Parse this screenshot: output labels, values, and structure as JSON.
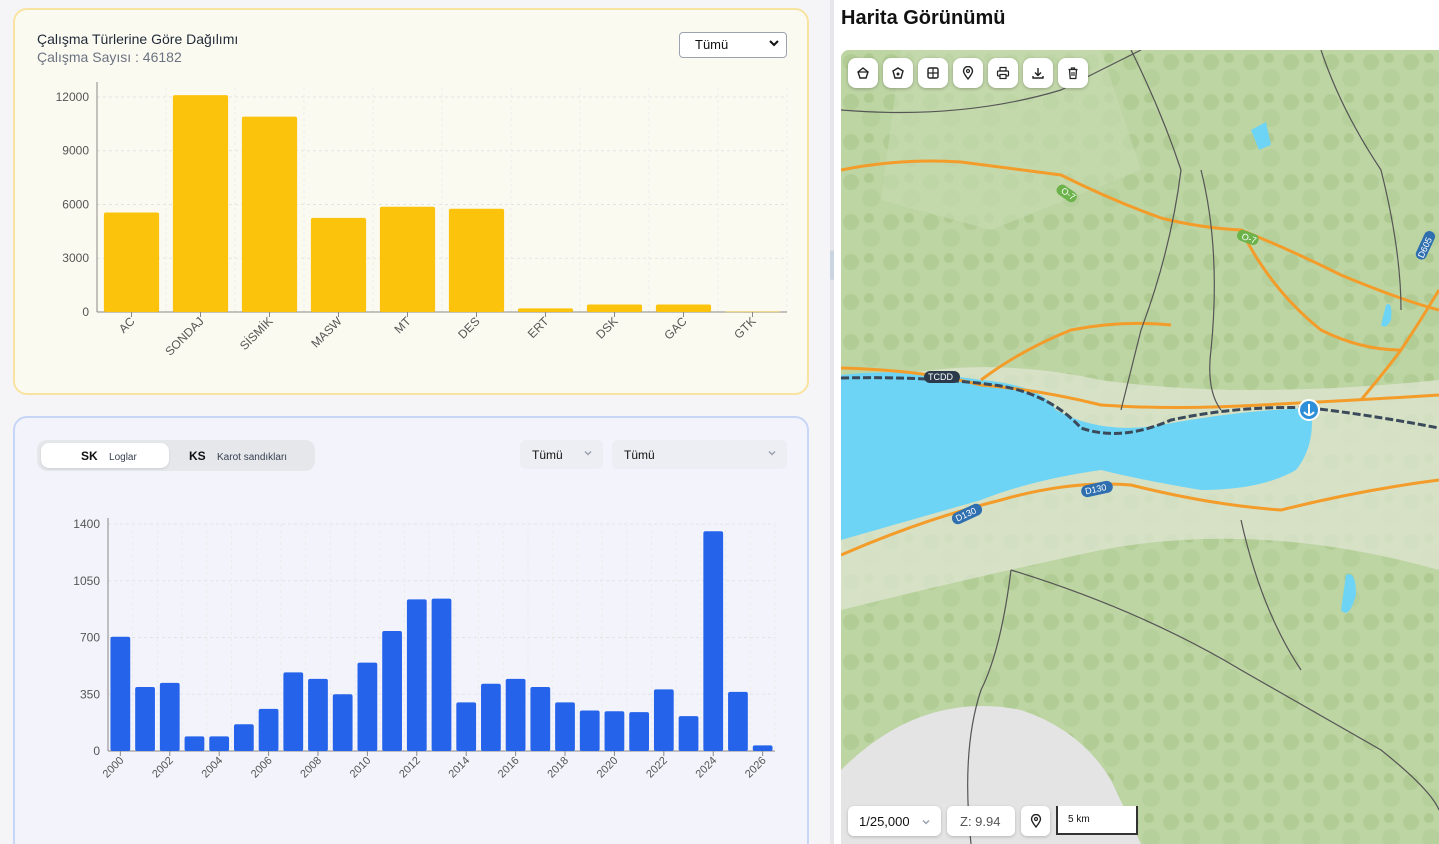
{
  "card1": {
    "title": "Çalışma Türlerine Göre Dağılımı",
    "subtitle": "Çalışma Sayısı : 46182",
    "filter_value": "Tümü"
  },
  "card2": {
    "toggle": [
      {
        "code": "SK",
        "label": "Loglar"
      },
      {
        "code": "KS",
        "label": "Karot sandıkları"
      }
    ],
    "filter1_value": "Tümü",
    "filter2_value": "Tümü"
  },
  "map": {
    "title": "Harita Görünümü",
    "scale_select": "1/25,000",
    "zoom_text": "Z: 9.94",
    "scale_bar_label": "5 km",
    "toolbar_icons": [
      "polygon-draw-icon",
      "polygon-edit-icon",
      "grid-icon",
      "location-pin-icon",
      "print-icon",
      "download-icon",
      "trash-icon"
    ],
    "labels": {
      "road_o7_a": "O-7",
      "road_o7_b": "O-7",
      "road_d605": "D605",
      "rail_tcdd": "TCDD",
      "road_d130_a": "D130",
      "road_d130_b": "D130"
    }
  },
  "chart_data": [
    {
      "type": "bar",
      "color": "#fcc30d",
      "categories": [
        "AC",
        "SONDAJ",
        "SİSMİK",
        "MASW",
        "MT",
        "DES",
        "ERT",
        "DSK",
        "GAC",
        "GTK"
      ],
      "values": [
        5550,
        12100,
        10900,
        5250,
        5870,
        5760,
        200,
        420,
        420,
        20
      ],
      "ylim": [
        0,
        12500
      ],
      "yticks": [
        0,
        3000,
        6000,
        9000,
        12000
      ],
      "grid": true
    },
    {
      "type": "bar",
      "color": "#2563eb",
      "categories": [
        "2000",
        "2001",
        "2002",
        "2003",
        "2004",
        "2005",
        "2006",
        "2007",
        "2008",
        "2009",
        "2010",
        "2011",
        "2012",
        "2013",
        "2014",
        "2015",
        "2016",
        "2017",
        "2018",
        "2019",
        "2020",
        "2021",
        "2022",
        "2023",
        "2024",
        "2025",
        "2026"
      ],
      "tick_labels": [
        "2000",
        "2002",
        "2004",
        "2006",
        "2008",
        "2010",
        "2012",
        "2014",
        "2016",
        "2018",
        "2020",
        "2022",
        "2024",
        "2026"
      ],
      "values": [
        705,
        395,
        420,
        90,
        90,
        165,
        260,
        485,
        445,
        350,
        545,
        740,
        935,
        940,
        300,
        415,
        445,
        395,
        300,
        250,
        245,
        240,
        380,
        215,
        1355,
        365,
        35
      ],
      "ylim": [
        0,
        1400
      ],
      "yticks": [
        0,
        350,
        700,
        1050,
        1400
      ],
      "grid": true
    }
  ]
}
